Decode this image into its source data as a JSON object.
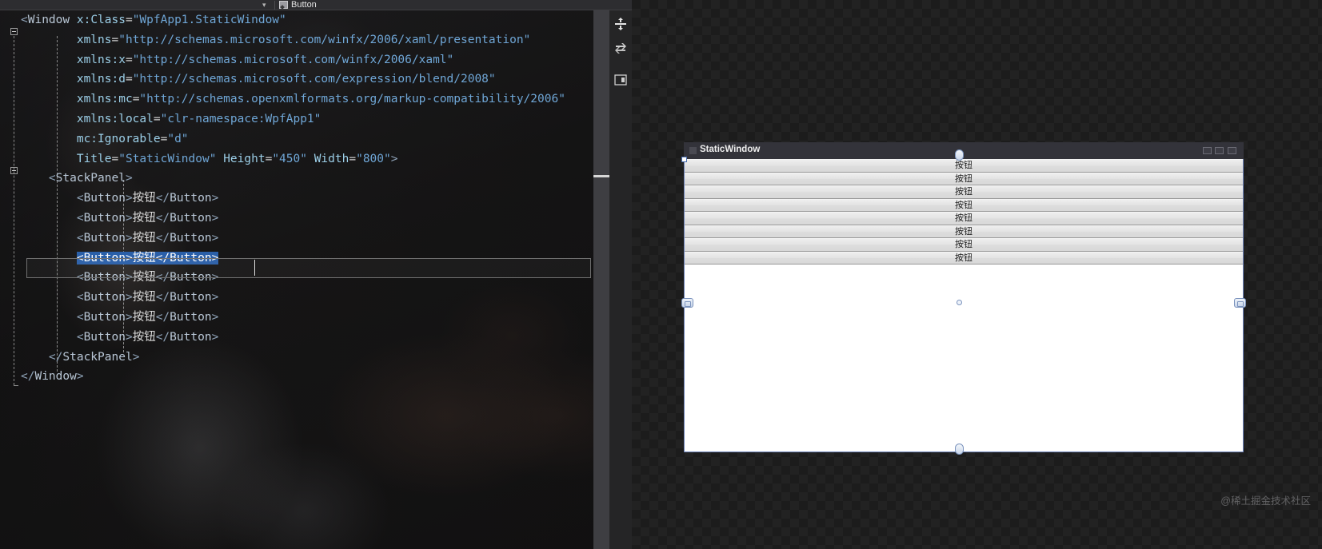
{
  "app": {
    "name": "Visual Studio XAML Designer",
    "theme_bg": "#1e1e1e",
    "accent": "#2a5fa8"
  },
  "nav_bar": {
    "chevron_icon": "chevron-down-icon",
    "member_icon": "member-button-icon",
    "member_label": "Button"
  },
  "editor": {
    "language": "XAML",
    "selected_line_index": 12,
    "caret_visible": true,
    "code_lines": [
      {
        "indent": 0,
        "fold": "start",
        "tokens": [
          {
            "t": "punct",
            "v": "<"
          },
          {
            "t": "tag",
            "v": "Window"
          },
          {
            "t": "text",
            "v": " "
          },
          {
            "t": "attr",
            "v": "x:Class"
          },
          {
            "t": "eq",
            "v": "="
          },
          {
            "t": "str",
            "v": "\"WpfApp1.StaticWindow\""
          }
        ]
      },
      {
        "indent": 8,
        "tokens": [
          {
            "t": "attr",
            "v": "xmlns"
          },
          {
            "t": "eq",
            "v": "="
          },
          {
            "t": "str",
            "v": "\"http://schemas.microsoft.com/winfx/2006/xaml/presentation\""
          }
        ]
      },
      {
        "indent": 8,
        "tokens": [
          {
            "t": "attr",
            "v": "xmlns:x"
          },
          {
            "t": "eq",
            "v": "="
          },
          {
            "t": "str",
            "v": "\"http://schemas.microsoft.com/winfx/2006/xaml\""
          }
        ]
      },
      {
        "indent": 8,
        "tokens": [
          {
            "t": "attr",
            "v": "xmlns:d"
          },
          {
            "t": "eq",
            "v": "="
          },
          {
            "t": "str",
            "v": "\"http://schemas.microsoft.com/expression/blend/2008\""
          }
        ]
      },
      {
        "indent": 8,
        "tokens": [
          {
            "t": "attr",
            "v": "xmlns:mc"
          },
          {
            "t": "eq",
            "v": "="
          },
          {
            "t": "str",
            "v": "\"http://schemas.openxmlformats.org/markup-compatibility/2006\""
          }
        ]
      },
      {
        "indent": 8,
        "tokens": [
          {
            "t": "attr",
            "v": "xmlns:local"
          },
          {
            "t": "eq",
            "v": "="
          },
          {
            "t": "str",
            "v": "\"clr-namespace:WpfApp1\""
          }
        ]
      },
      {
        "indent": 8,
        "tokens": [
          {
            "t": "attr",
            "v": "mc:Ignorable"
          },
          {
            "t": "eq",
            "v": "="
          },
          {
            "t": "str",
            "v": "\"d\""
          }
        ]
      },
      {
        "indent": 8,
        "tokens": [
          {
            "t": "attr",
            "v": "Title"
          },
          {
            "t": "eq",
            "v": "="
          },
          {
            "t": "str",
            "v": "\"StaticWindow\""
          },
          {
            "t": "text",
            "v": " "
          },
          {
            "t": "attr",
            "v": "Height"
          },
          {
            "t": "eq",
            "v": "="
          },
          {
            "t": "str",
            "v": "\"450\""
          },
          {
            "t": "text",
            "v": " "
          },
          {
            "t": "attr",
            "v": "Width"
          },
          {
            "t": "eq",
            "v": "="
          },
          {
            "t": "str",
            "v": "\"800\""
          },
          {
            "t": "punct",
            "v": ">"
          }
        ]
      },
      {
        "indent": 4,
        "fold": "start",
        "tokens": [
          {
            "t": "punct",
            "v": "<"
          },
          {
            "t": "tag",
            "v": "StackPanel"
          },
          {
            "t": "punct",
            "v": ">"
          }
        ]
      },
      {
        "indent": 8,
        "tokens": [
          {
            "t": "punct",
            "v": "<"
          },
          {
            "t": "tag",
            "v": "Button"
          },
          {
            "t": "punct",
            "v": ">"
          },
          {
            "t": "text",
            "v": "按钮"
          },
          {
            "t": "punct",
            "v": "</"
          },
          {
            "t": "tag",
            "v": "Button"
          },
          {
            "t": "punct",
            "v": ">"
          }
        ]
      },
      {
        "indent": 8,
        "tokens": [
          {
            "t": "punct",
            "v": "<"
          },
          {
            "t": "tag",
            "v": "Button"
          },
          {
            "t": "punct",
            "v": ">"
          },
          {
            "t": "text",
            "v": "按钮"
          },
          {
            "t": "punct",
            "v": "</"
          },
          {
            "t": "tag",
            "v": "Button"
          },
          {
            "t": "punct",
            "v": ">"
          }
        ]
      },
      {
        "indent": 8,
        "tokens": [
          {
            "t": "punct",
            "v": "<"
          },
          {
            "t": "tag",
            "v": "Button"
          },
          {
            "t": "punct",
            "v": ">"
          },
          {
            "t": "text",
            "v": "按钮"
          },
          {
            "t": "punct",
            "v": "</"
          },
          {
            "t": "tag",
            "v": "Button"
          },
          {
            "t": "punct",
            "v": ">"
          }
        ]
      },
      {
        "indent": 8,
        "selected": true,
        "tokens": [
          {
            "t": "punct",
            "v": "<"
          },
          {
            "t": "tag",
            "v": "Button"
          },
          {
            "t": "punct",
            "v": ">"
          },
          {
            "t": "text",
            "v": "按钮"
          },
          {
            "t": "punct",
            "v": "</"
          },
          {
            "t": "tag",
            "v": "Button"
          },
          {
            "t": "punct",
            "v": ">"
          }
        ]
      },
      {
        "indent": 8,
        "tokens": [
          {
            "t": "punct",
            "v": "<"
          },
          {
            "t": "tag",
            "v": "Button"
          },
          {
            "t": "punct",
            "v": ">"
          },
          {
            "t": "text",
            "v": "按钮"
          },
          {
            "t": "punct",
            "v": "</"
          },
          {
            "t": "tag",
            "v": "Button"
          },
          {
            "t": "punct",
            "v": ">"
          }
        ]
      },
      {
        "indent": 8,
        "tokens": [
          {
            "t": "punct",
            "v": "<"
          },
          {
            "t": "tag",
            "v": "Button"
          },
          {
            "t": "punct",
            "v": ">"
          },
          {
            "t": "text",
            "v": "按钮"
          },
          {
            "t": "punct",
            "v": "</"
          },
          {
            "t": "tag",
            "v": "Button"
          },
          {
            "t": "punct",
            "v": ">"
          }
        ]
      },
      {
        "indent": 8,
        "tokens": [
          {
            "t": "punct",
            "v": "<"
          },
          {
            "t": "tag",
            "v": "Button"
          },
          {
            "t": "punct",
            "v": ">"
          },
          {
            "t": "text",
            "v": "按钮"
          },
          {
            "t": "punct",
            "v": "</"
          },
          {
            "t": "tag",
            "v": "Button"
          },
          {
            "t": "punct",
            "v": ">"
          }
        ]
      },
      {
        "indent": 8,
        "tokens": [
          {
            "t": "punct",
            "v": "<"
          },
          {
            "t": "tag",
            "v": "Button"
          },
          {
            "t": "punct",
            "v": ">"
          },
          {
            "t": "text",
            "v": "按钮"
          },
          {
            "t": "punct",
            "v": "</"
          },
          {
            "t": "tag",
            "v": "Button"
          },
          {
            "t": "punct",
            "v": ">"
          }
        ]
      },
      {
        "indent": 4,
        "fold": "end",
        "tokens": [
          {
            "t": "punct",
            "v": "</"
          },
          {
            "t": "tag",
            "v": "StackPanel"
          },
          {
            "t": "punct",
            "v": ">"
          }
        ]
      },
      {
        "indent": 0,
        "fold": "end",
        "tokens": [
          {
            "t": "punct",
            "v": "</"
          },
          {
            "t": "tag",
            "v": "Window"
          },
          {
            "t": "punct",
            "v": ">"
          }
        ]
      }
    ]
  },
  "editor_toolstrip": {
    "icons": [
      {
        "name": "split-view-icon",
        "title": "Split view"
      },
      {
        "name": "swap-panes-icon",
        "title": "Swap panes"
      },
      {
        "name": "collapse-pane-icon",
        "title": "Collapse pane"
      }
    ]
  },
  "scrollbar": {
    "change_marker_color": "#e7e78c",
    "thumb_color": "#9e9e9e",
    "up_arrow_icon": "scroll-up-arrow-icon"
  },
  "designer": {
    "window_title": "StaticWindow",
    "title_icon": "window-icon",
    "caption_buttons": [
      "minimize-button",
      "maximize-button",
      "close-button"
    ],
    "buttons": [
      {
        "label": "按钮"
      },
      {
        "label": "按钮"
      },
      {
        "label": "按钮"
      },
      {
        "label": "按钮"
      },
      {
        "label": "按钮"
      },
      {
        "label": "按钮"
      },
      {
        "label": "按钮"
      },
      {
        "label": "按钮"
      }
    ],
    "selection_border_color": "#6d82b8",
    "adorners": [
      {
        "name": "resize-handle-top-left",
        "kind": "handle"
      },
      {
        "name": "resize-grip-top",
        "kind": "grip"
      },
      {
        "name": "anchor-dot-center",
        "kind": "dot"
      },
      {
        "name": "align-pill-left",
        "kind": "pill"
      },
      {
        "name": "align-pill-right",
        "kind": "pill"
      },
      {
        "name": "resize-grip-bottom",
        "kind": "grip"
      }
    ]
  },
  "watermark": {
    "text": "@稀土掘金技术社区"
  }
}
